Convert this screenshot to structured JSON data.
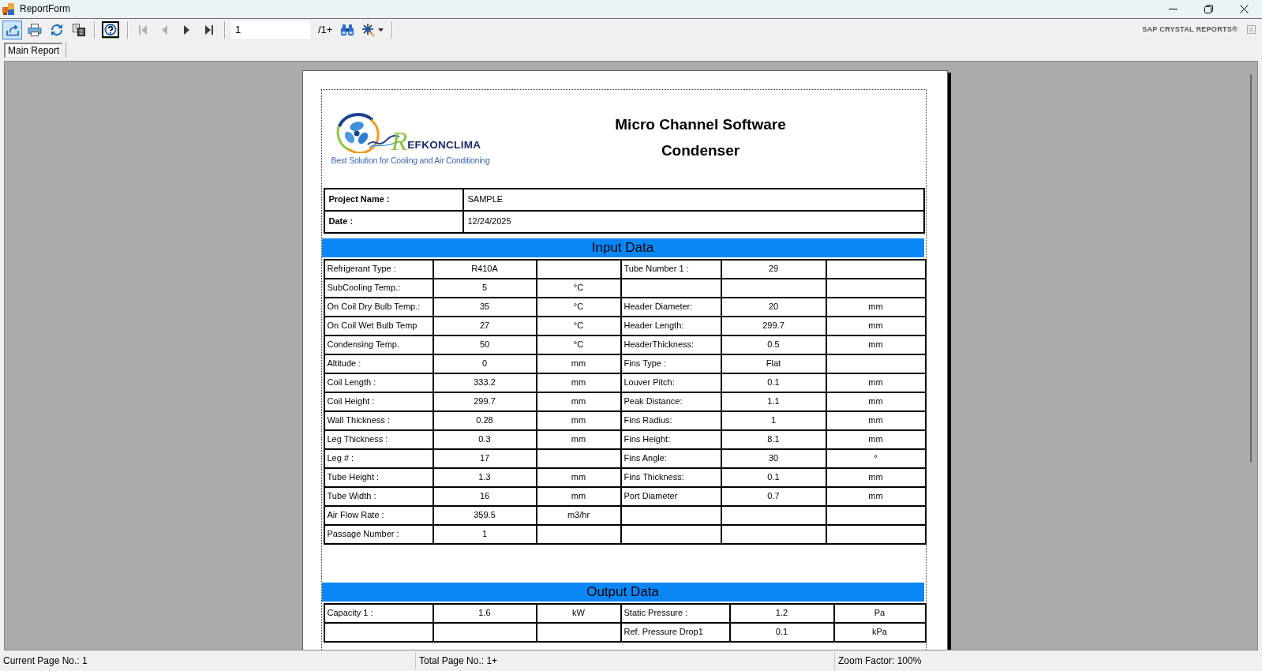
{
  "window": {
    "title": "ReportForm"
  },
  "toolbar": {
    "groups": [
      [
        {
          "kind": "export",
          "selected": true,
          "disabled": false
        },
        {
          "kind": "print",
          "selected": false,
          "disabled": false
        },
        {
          "kind": "refresh",
          "selected": false,
          "disabled": false
        },
        {
          "kind": "tree",
          "selected": false,
          "disabled": false
        }
      ],
      [
        {
          "kind": "panel",
          "selected": false,
          "disabled": false
        }
      ],
      [
        {
          "kind": "first",
          "selected": false,
          "disabled": true
        },
        {
          "kind": "previous",
          "selected": false,
          "disabled": true
        },
        {
          "kind": "next",
          "selected": false,
          "disabled": false
        },
        {
          "kind": "last",
          "selected": false,
          "disabled": false
        }
      ]
    ],
    "page_field": {
      "value": "1"
    },
    "page_total": "/1+",
    "search_tools": [
      {
        "kind": "find",
        "selected": false,
        "disabled": false
      },
      {
        "kind": "zoom",
        "selected": false,
        "disabled": false
      }
    ],
    "brand": "SAP CRYSTAL REPORTS®"
  },
  "tabs": [
    {
      "label": "Main Report",
      "selected": true
    }
  ],
  "report": {
    "logo": {
      "initial": "R",
      "wordmark": "EFKONCLIMA",
      "tagline": "Best Solution for Cooling and Air Conditioning"
    },
    "title": "Micro Channel Software",
    "subtitle": "Condenser",
    "project": [
      {
        "label": "Project Name :",
        "value": "SAMPLE"
      },
      {
        "label": "Date :",
        "value": "12/24/2025"
      }
    ],
    "sections": [
      {
        "title": "Input Data",
        "rows": [
          {
            "left": {
              "label": "Refrigerant Type :",
              "value": "R410A"
            },
            "right": {
              "label": "Tube Number 1 :",
              "value": "29"
            }
          },
          {
            "left": {
              "label": "SubCooling Temp.:",
              "value": "5",
              "unit": "°C"
            }
          },
          {
            "left": {
              "label": "On Coil Dry Bulb Temp.:",
              "value": "35",
              "unit": "°C"
            },
            "right": {
              "label": "Header Diameter:",
              "value": "20",
              "unit": "mm"
            }
          },
          {
            "left": {
              "label": "On Coil Wet Bulb Temp",
              "value": "27",
              "unit": "°C"
            },
            "right": {
              "label": "Header Length:",
              "value": "299.7",
              "unit": "mm"
            }
          },
          {
            "left": {
              "label": "Condensing Temp.",
              "value": "50",
              "unit": "°C"
            },
            "right": {
              "label": "HeaderThickness:",
              "value": "0.5",
              "unit": "mm"
            }
          },
          {
            "left": {
              "label": "Altitude :",
              "value": "0",
              "unit": "mm"
            },
            "right": {
              "label": "Fins Type :",
              "value": "Flat"
            }
          },
          {
            "left": {
              "label": "Coil Length :",
              "value": "333.2",
              "unit": "mm"
            },
            "right": {
              "label": "Louver Pitch:",
              "value": "0.1",
              "unit": "mm"
            }
          },
          {
            "left": {
              "label": "Coil Height :",
              "value": "299.7",
              "unit": "mm"
            },
            "right": {
              "label": "Peak Distance:",
              "value": "1.1",
              "unit": "mm"
            }
          },
          {
            "left": {
              "label": "Wall Thickness :",
              "value": "0.28",
              "unit": "mm"
            },
            "right": {
              "label": "Fins Radius:",
              "value": "1",
              "unit": "mm"
            }
          },
          {
            "left": {
              "label": "Leg Thickness :",
              "value": "0.3",
              "unit": "mm"
            },
            "right": {
              "label": "Fins Height:",
              "value": "8.1",
              "unit": "mm"
            }
          },
          {
            "left": {
              "label": "Leg # :",
              "value": "17"
            },
            "right": {
              "label": "Fins Angle:",
              "value": "30",
              "unit": "°"
            }
          },
          {
            "left": {
              "label": "Tube Height :",
              "value": "1.3",
              "unit": "mm"
            },
            "right": {
              "label": "Fins Thickness:",
              "value": "0.1",
              "unit": "mm"
            }
          },
          {
            "left": {
              "label": "Tube Width :",
              "value": "16",
              "unit": "mm"
            },
            "right": {
              "label": "Port Diameter",
              "value": "0.7",
              "unit": "mm"
            }
          },
          {
            "left": {
              "label": "Air Flow Rate :",
              "value": "359.5",
              "unit": "m3/hr"
            }
          },
          {
            "left": {
              "label": "Passage Number :",
              "value": "1"
            }
          }
        ]
      },
      {
        "title": "Output Data",
        "rows": [
          {
            "left": {
              "label": "Capacity 1 :",
              "value": "1.6",
              "unit": "kW"
            },
            "right": {
              "label": "Static Pressure :",
              "value": "1.2",
              "unit": "Pa"
            }
          },
          {
            "right": {
              "label": "Ref. Pressure Drop1",
              "value": "0.1",
              "unit": "kPa"
            }
          }
        ]
      }
    ]
  },
  "status_bar": [
    "Current Page No.: 1",
    "Total Page No.: 1+",
    "Zoom Factor: 100%"
  ]
}
